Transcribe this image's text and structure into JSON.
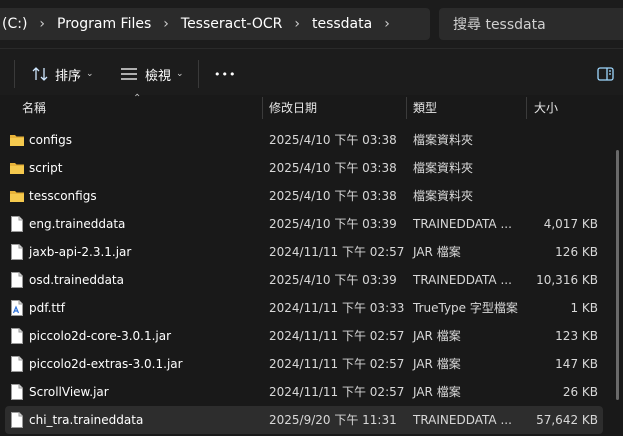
{
  "address": {
    "breadcrumbs": [
      "(C:)",
      "Program Files",
      "Tesseract-OCR",
      "tessdata"
    ],
    "separator": "›"
  },
  "search": {
    "placeholder": "搜尋 tessdata"
  },
  "toolbar": {
    "sort_label": "排序",
    "view_label": "檢視",
    "more_label": "•••"
  },
  "columns": {
    "name": "名稱",
    "date": "修改日期",
    "type": "類型",
    "size": "大小"
  },
  "files": [
    {
      "name": "configs",
      "date": "2025/4/10 下午 03:38",
      "type": "檔案資料夾",
      "size": "",
      "icon": "folder-icon"
    },
    {
      "name": "script",
      "date": "2025/4/10 下午 03:38",
      "type": "檔案資料夾",
      "size": "",
      "icon": "folder-icon"
    },
    {
      "name": "tessconfigs",
      "date": "2025/4/10 下午 03:38",
      "type": "檔案資料夾",
      "size": "",
      "icon": "folder-icon"
    },
    {
      "name": "eng.traineddata",
      "date": "2025/4/10 下午 03:39",
      "type": "TRAINEDDATA ...",
      "size": "4,017 KB",
      "icon": "file-icon"
    },
    {
      "name": "jaxb-api-2.3.1.jar",
      "date": "2024/11/11 下午 02:57",
      "type": "JAR 檔案",
      "size": "126 KB",
      "icon": "file-icon"
    },
    {
      "name": "osd.traineddata",
      "date": "2025/4/10 下午 03:39",
      "type": "TRAINEDDATA ...",
      "size": "10,316 KB",
      "icon": "file-icon"
    },
    {
      "name": "pdf.ttf",
      "date": "2024/11/11 下午 03:33",
      "type": "TrueType 字型檔案",
      "size": "1 KB",
      "icon": "font-file-icon"
    },
    {
      "name": "piccolo2d-core-3.0.1.jar",
      "date": "2024/11/11 下午 02:57",
      "type": "JAR 檔案",
      "size": "123 KB",
      "icon": "file-icon"
    },
    {
      "name": "piccolo2d-extras-3.0.1.jar",
      "date": "2024/11/11 下午 02:57",
      "type": "JAR 檔案",
      "size": "147 KB",
      "icon": "file-icon"
    },
    {
      "name": "ScrollView.jar",
      "date": "2024/11/11 下午 02:57",
      "type": "JAR 檔案",
      "size": "26 KB",
      "icon": "file-icon"
    },
    {
      "name": "chi_tra.traineddata",
      "date": "2025/9/20 下午 11:31",
      "type": "TRAINEDDATA ...",
      "size": "57,642 KB",
      "icon": "file-icon",
      "selected": true
    }
  ],
  "colors": {
    "folder": "#e8b339",
    "accent": "#4cc2ff",
    "selected_row": "#2d2d2d"
  }
}
